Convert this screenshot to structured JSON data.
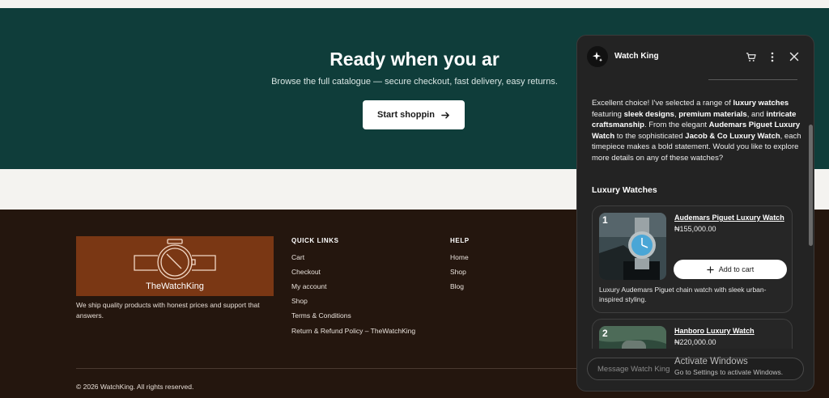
{
  "hero": {
    "title": "Ready when you ar",
    "subtitle": "Browse the full catalogue — secure checkout, fast delivery, easy returns.",
    "cta_label": "Start shoppin",
    "cta_icon": "arrow-right-icon",
    "background_color": "#0f3d3a"
  },
  "footer": {
    "logo_text": "TheWatchKing",
    "tagline": "We ship quality products with honest prices and support that answers.",
    "quick_links": {
      "heading": "QUICK LINKS",
      "items": [
        "Cart",
        "Checkout",
        "My account",
        "Shop",
        "Terms & Conditions",
        "Return & Refund Policy – TheWatchKing"
      ]
    },
    "help": {
      "heading": "HELP",
      "items": [
        "Home",
        "Shop",
        "Blog"
      ]
    },
    "copyright": "© 2026 WatchKing. All rights reserved.",
    "background_color": "#24160e",
    "logo_background": "#7a3714"
  },
  "chat": {
    "bot_name": "Watch King",
    "header_icons": [
      "sparkle-icon",
      "cart-icon",
      "more-vertical-icon",
      "close-icon"
    ],
    "message": {
      "p1": "Excellent choice! I've selected a range of ",
      "b1": "luxury watches",
      "p2": " featuring ",
      "b2": "sleek designs",
      "p3": ", ",
      "b3": "premium materials",
      "p4": ", and ",
      "b4": "intricate craftsmanship",
      "p5": ". From the elegant ",
      "b5": "Audemars Piguet Luxury Watch",
      "p6": " to the sophisticated ",
      "b6": "Jacob & Co Luxury Watch",
      "p7": ", each timepiece makes a bold statement. Would you like to explore more details on any of these watches?"
    },
    "section_title": "Luxury Watches",
    "products": [
      {
        "rank": "1",
        "title": "Audemars Piguet Luxury Watch",
        "price": "₦155,000.00",
        "add_label": "Add to cart",
        "description": "Luxury Audemars Piguet chain watch with sleek urban-inspired styling."
      },
      {
        "rank": "2",
        "title": "Hanboro Luxury Watch",
        "price": "₦220,000.00"
      }
    ],
    "input_placeholder": "Message Watch King"
  },
  "watermark": {
    "title": "Activate Windows",
    "subtitle": "Go to Settings to activate Windows."
  }
}
